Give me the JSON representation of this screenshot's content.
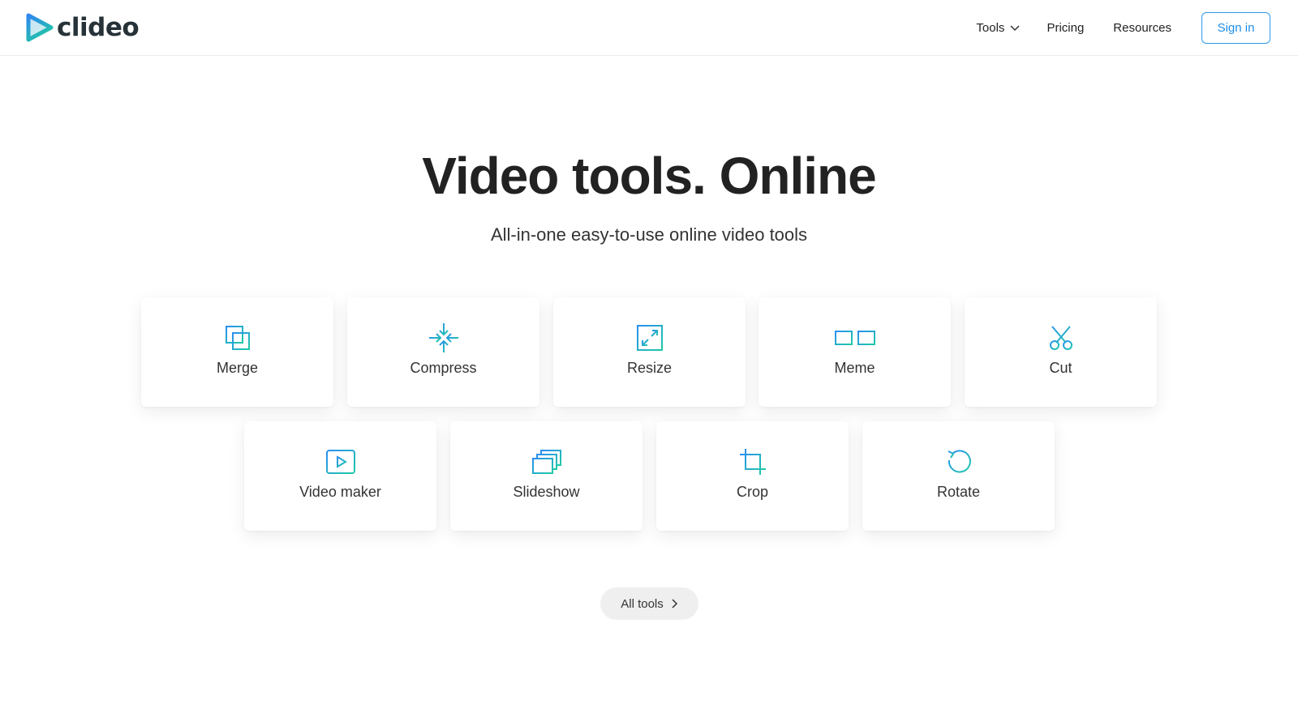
{
  "header": {
    "logo_text": "clideo",
    "nav": {
      "tools": "Tools",
      "pricing": "Pricing",
      "resources": "Resources"
    },
    "signin": "Sign in"
  },
  "hero": {
    "title": "Video tools. Online",
    "subtitle": "All-in-one easy-to-use online video tools"
  },
  "tools": [
    {
      "label": "Merge",
      "icon": "merge-icon"
    },
    {
      "label": "Compress",
      "icon": "compress-icon"
    },
    {
      "label": "Resize",
      "icon": "resize-icon"
    },
    {
      "label": "Meme",
      "icon": "meme-icon"
    },
    {
      "label": "Cut",
      "icon": "cut-icon"
    },
    {
      "label": "Video maker",
      "icon": "video-maker-icon"
    },
    {
      "label": "Slideshow",
      "icon": "slideshow-icon"
    },
    {
      "label": "Crop",
      "icon": "crop-icon"
    },
    {
      "label": "Rotate",
      "icon": "rotate-icon"
    }
  ],
  "all_tools": "All tools",
  "colors": {
    "accent_blue": "#2b9ae9",
    "icon_gradient_start": "#2b8ff0",
    "icon_gradient_end": "#1fc9a8",
    "text": "#222222"
  }
}
